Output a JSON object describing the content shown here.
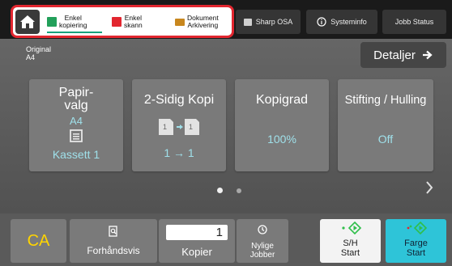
{
  "topbar": {
    "shortcuts": [
      {
        "label_line1": "Enkel",
        "label_line2": "kopiering"
      },
      {
        "label_line1": "Enkel",
        "label_line2": "skann"
      },
      {
        "label_line1": "Dokument",
        "label_line2": "Arkivering"
      }
    ],
    "sharp_osa": "Sharp OSA",
    "systeminfo": "Systeminfo",
    "job_status": "Jobb Status"
  },
  "original": {
    "label": "Original",
    "value": "A4"
  },
  "details_label": "Detaljer",
  "tiles": {
    "paper": {
      "title_line1": "Papir-",
      "title_line2": "valg",
      "size": "A4",
      "tray": "Kassett 1"
    },
    "duplex": {
      "title": "2-Sidig Kopi",
      "mode": "1 → 1"
    },
    "density": {
      "title": "Kopigrad",
      "value": "100%"
    },
    "staple": {
      "title": "Stifting / Hulling",
      "value": "Off"
    }
  },
  "bottom": {
    "ca": "CA",
    "preview": "Forhåndsvis",
    "copies_label": "Kopier",
    "copies_value": "1",
    "recent_line1": "Nylige",
    "recent_line2": "Jobber",
    "bw_start_line1": "S/H",
    "bw_start_line2": "Start",
    "color_start_line1": "Farge",
    "color_start_line2": "Start"
  },
  "colors": {
    "accent_teal": "#16a27e",
    "highlight_red": "#e2262f",
    "ca_yellow": "#ffd400",
    "value_cyan": "#9fe0ea",
    "color_start_bg": "#2ec4d8",
    "start_green": "#2fbf4a"
  },
  "icons": [
    "home-icon",
    "copy-icon",
    "scan-icon",
    "filing-icon",
    "osa-icon",
    "info-icon",
    "arrow-right-icon",
    "tray-icon",
    "duplex-icon",
    "preview-icon",
    "history-icon",
    "start-icon"
  ],
  "pager": {
    "current_page": 1,
    "total_pages": 2
  }
}
